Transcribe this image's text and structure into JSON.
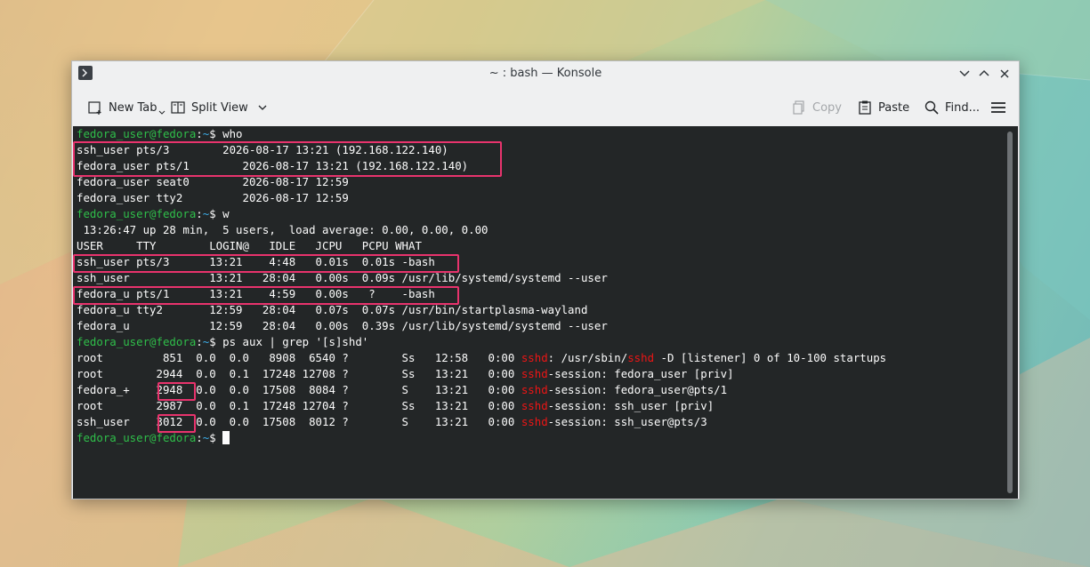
{
  "window": {
    "title": "~ : bash — Konsole"
  },
  "toolbar": {
    "new_tab": "New Tab",
    "split_view": "Split View",
    "copy": "Copy",
    "paste": "Paste",
    "find": "Find..."
  },
  "terminal": {
    "prompt_user": "fedora_user@fedora",
    "prompt_sep": ":",
    "prompt_path": "~",
    "prompt_dollar": "$ ",
    "lines": [
      {
        "prompt": true,
        "text": "who"
      },
      {
        "text": "ssh_user pts/3        2026-08-17 13:21 (192.168.122.140)"
      },
      {
        "text": "fedora_user pts/1        2026-08-17 13:21 (192.168.122.140)"
      },
      {
        "text": "fedora_user seat0        2026-08-17 12:59"
      },
      {
        "text": "fedora_user tty2         2026-08-17 12:59"
      },
      {
        "prompt": true,
        "text": "w"
      },
      {
        "text": " 13:26:47 up 28 min,  5 users,  load average: 0.00, 0.00, 0.00"
      },
      {
        "text": "USER     TTY        LOGIN@   IDLE   JCPU   PCPU WHAT"
      },
      {
        "text": "ssh_user pts/3      13:21    4:48   0.01s  0.01s -bash"
      },
      {
        "text": "ssh_user            13:21   28:04   0.00s  0.09s /usr/lib/systemd/systemd --user"
      },
      {
        "text": "fedora_u pts/1      13:21    4:59   0.00s   ?    -bash"
      },
      {
        "text": "fedora_u tty2       12:59   28:04   0.07s  0.07s /usr/bin/startplasma-wayland"
      },
      {
        "text": "fedora_u            12:59   28:04   0.00s  0.39s /usr/lib/systemd/systemd --user"
      },
      {
        "prompt": true,
        "text": "ps aux | grep '[s]shd'"
      },
      {
        "segments": [
          "root         851  0.0  0.0   8908  6540 ?        Ss   12:58   0:00 ",
          "sshd",
          ": /usr/sbin/",
          "sshd",
          " -D [listener] 0 of 10-100 startups"
        ]
      },
      {
        "segments": [
          "root        2944  0.0  0.1  17248 12708 ?        Ss   13:21   0:00 ",
          "sshd",
          "-session: fedora_user [priv]"
        ]
      },
      {
        "segments": [
          "fedora_+    2948  0.0  0.0  17508  8084 ?        S    13:21   0:00 ",
          "sshd",
          "-session: fedora_user@pts/1"
        ]
      },
      {
        "segments": [
          "root        2987  0.0  0.1  17248 12704 ?        Ss   13:21   0:00 ",
          "sshd",
          "-session: ssh_user [priv]"
        ]
      },
      {
        "segments": [
          "ssh_user    3012  0.0  0.0  17508  8012 ?        S    13:21   0:00 ",
          "sshd",
          "-session: ssh_user@pts/3"
        ]
      },
      {
        "prompt": true,
        "text": "",
        "cursor": true
      }
    ]
  }
}
